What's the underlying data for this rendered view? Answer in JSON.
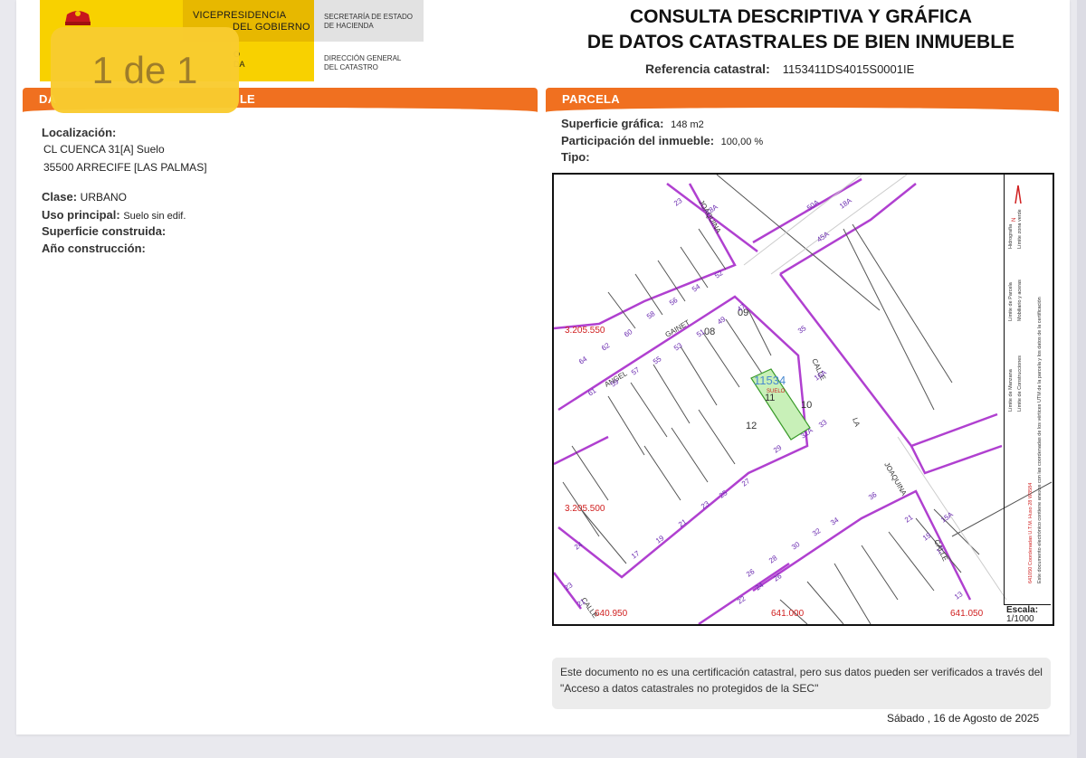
{
  "header": {
    "vp_line1": "VICEPRESIDENCIA",
    "vp_line2": "DEL GOBIERNO",
    "ministry_fragment1": "O",
    "ministry_fragment2": "DA",
    "secretaria_l1": "SECRETARÍA DE ESTADO",
    "secretaria_l2": "DE HACIENDA",
    "direccion_l1": "DIRECCIÓN GENERAL",
    "direccion_l2": "DEL CATASTRO",
    "title_l1": "CONSULTA DESCRIPTIVA Y GRÁFICA",
    "title_l2": "DE DATOS CATASTRALES DE BIEN INMUEBLE",
    "ref_label": "Referencia catastral:",
    "ref_value": "1153411DS4015S0001IE"
  },
  "pager": {
    "label": "1 de 1"
  },
  "left_section": {
    "bar_start": "DA",
    "bar_end": "LE",
    "localizacion_label": "Localización:",
    "address_l1": "CL CUENCA 31[A] Suelo",
    "address_l2": "35500 ARRECIFE [LAS PALMAS]",
    "clase_label": "Clase:",
    "clase_value": "URBANO",
    "uso_label": "Uso principal:",
    "uso_value": "Suelo sin edif.",
    "superficie_label": "Superficie construida:",
    "anio_label": "Año construcción:"
  },
  "parcela": {
    "bar_title": "PARCELA",
    "superficie_label": "Superficie gráfica:",
    "superficie_value": "148 m2",
    "participacion_label": "Participación del inmueble:",
    "participacion_value": "100,00 %",
    "tipo_label": "Tipo:"
  },
  "map": {
    "coord_y1": "3.205.550",
    "coord_y2": "3.205.500",
    "coord_x1": "640.950",
    "coord_x2": "641.000",
    "coord_x3": "641.050",
    "parcel_id": "11534",
    "parcel_sub": "SUELO",
    "block_labels": [
      "09",
      "08",
      "11",
      "10",
      "12"
    ],
    "street_gainet": "GAINET",
    "street_angel": "ANGEL",
    "street_joaquina_top": "JOAQUINA",
    "street_joaquina_bottom": "JOAQUINA",
    "street_calle_right": "CALLE",
    "street_calle_bottom": "CALLE",
    "street_calle_lower": "CALLE",
    "street_la": "LA",
    "numbers": [
      "23",
      "18A",
      "50A",
      "45A",
      "52",
      "54",
      "56",
      "58",
      "60",
      "62",
      "64",
      "61",
      "59",
      "57",
      "55",
      "53",
      "51",
      "49",
      "47",
      "33",
      "31A",
      "29",
      "27",
      "25",
      "23",
      "21",
      "19",
      "17",
      "24",
      "26",
      "28",
      "30",
      "32",
      "34",
      "36",
      "21",
      "19",
      "17",
      "13",
      "18A",
      "22",
      "24",
      "26",
      "15A",
      "23",
      "21",
      "16A",
      "35"
    ],
    "legend": {
      "l1": "Límite de Manzana",
      "l2": "Límite de Parcela",
      "l3": "Hidrografía",
      "l4": "Límite de Construcciones",
      "l5": "Mobiliario y aceras",
      "l6": "Límite zona verde",
      "note1": "641050 Coordenadas U.T.M. Huso 28 W3584",
      "note2": "Este documento electrónico contiene anexos con las coordenadas de los vértices UTM de la parcela y los datos de la certificación"
    },
    "scale_label": "Escala:",
    "scale_value": "1/1000"
  },
  "footer": {
    "notice": "Este documento no es una certificación catastral, pero sus datos pueden ser verificados a través del \"Acceso a datos catastrales no protegidos de la SEC\"",
    "date": "Sábado , 16 de Agosto de 2025"
  },
  "colors": {
    "orange": "#f07020",
    "yellow": "#f8d100",
    "parcel_lines": "#b040d0",
    "parcel_fill": "#c8f0b8"
  }
}
